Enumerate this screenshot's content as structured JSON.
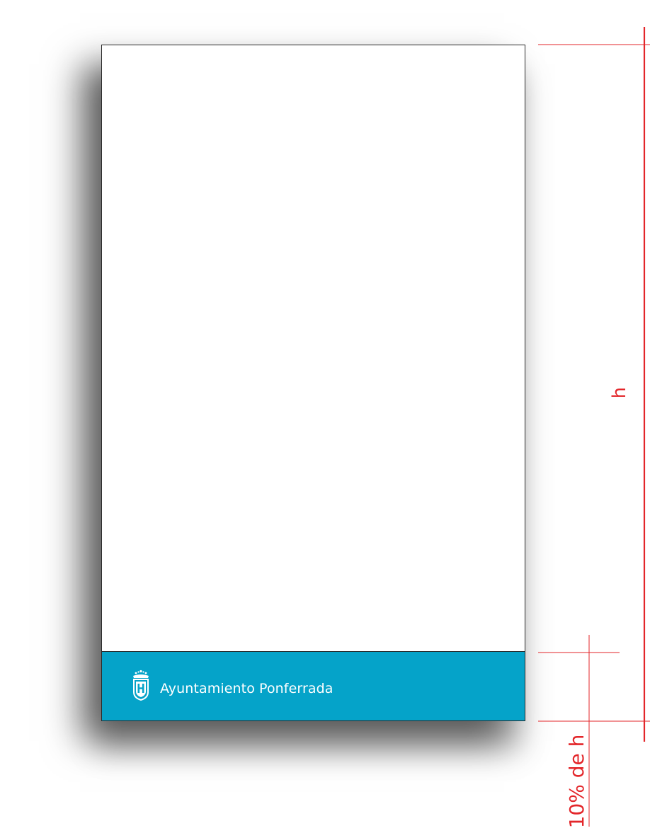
{
  "brand": {
    "name": "Ayuntamiento Ponferrada",
    "crest_icon": "city-crest-icon"
  },
  "annotations": {
    "height_label": "h",
    "footer_label": "10% de h"
  },
  "colors": {
    "band": "#05a3c9",
    "measure": "#e3262a",
    "sheet_border": "#2a2a2a"
  }
}
